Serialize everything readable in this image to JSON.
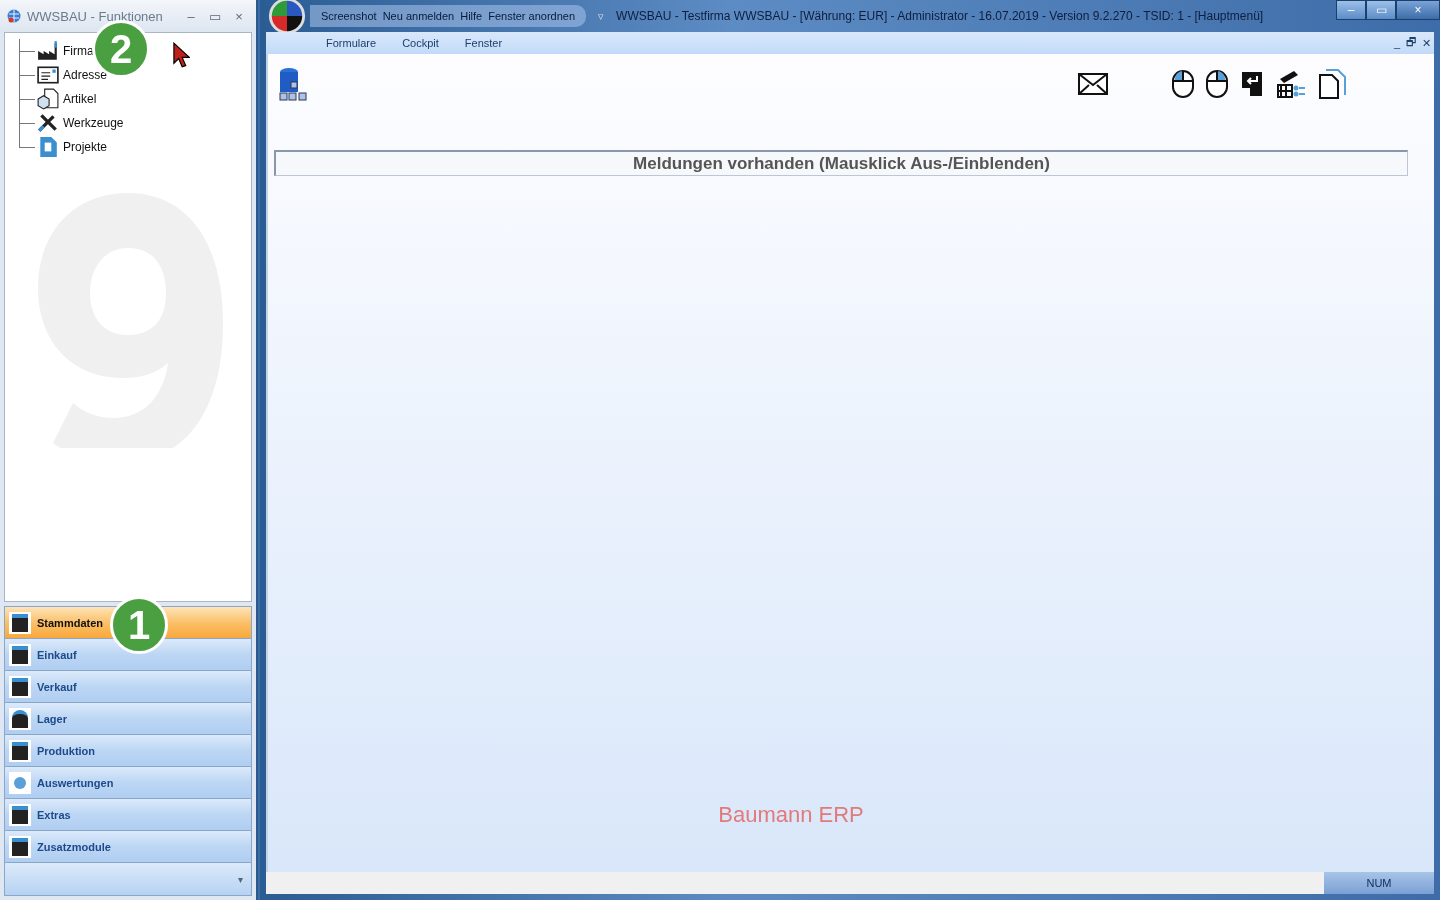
{
  "functions_window": {
    "title": "WWSBAU - Funktionen",
    "minimize": "–",
    "maximize": "▭",
    "close": "×",
    "tree": [
      {
        "label": "Firma"
      },
      {
        "label": "Adresse"
      },
      {
        "label": "Artikel"
      },
      {
        "label": "Werkzeuge"
      },
      {
        "label": "Projekte"
      }
    ],
    "nav": [
      {
        "label": "Stammdaten",
        "selected": true
      },
      {
        "label": "Einkauf",
        "selected": false
      },
      {
        "label": "Verkauf",
        "selected": false
      },
      {
        "label": "Lager",
        "selected": false
      },
      {
        "label": "Produktion",
        "selected": false
      },
      {
        "label": "Auswertungen",
        "selected": false
      },
      {
        "label": "Extras",
        "selected": false
      },
      {
        "label": "Zusatzmodule",
        "selected": false
      }
    ],
    "more": "▾"
  },
  "main_window": {
    "quick_menu": [
      "Screenshot",
      "Neu anmelden",
      "Hilfe",
      "Fenster anordnen"
    ],
    "quick_caret": "▿",
    "title": "WWSBAU - Testfirma WWSBAU - [Währung: EUR] - Administrator - 16.07.2019 - Version 9.2.270 - TSID: 1  - [Hauptmenü]",
    "menu": [
      "Formulare",
      "Cockpit",
      "Fenster"
    ],
    "mdi_controls": [
      "_",
      "🗗",
      "✕"
    ],
    "message_bar": "Meldungen vorhanden  (Mausklick Aus-/Einblenden)",
    "footer": "Baumann ERP",
    "status": {
      "indicator": "NUM"
    }
  },
  "annotations": [
    {
      "label": "1"
    },
    {
      "label": "2"
    }
  ]
}
